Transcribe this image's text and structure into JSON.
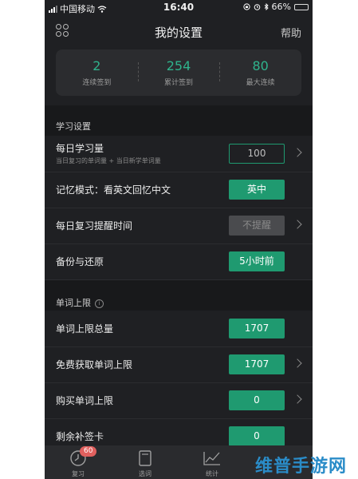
{
  "status_bar": {
    "carrier": "中国移动",
    "time": "16:40",
    "battery": "66%",
    "battery_level": 0.66
  },
  "nav": {
    "title": "我的设置",
    "help": "帮助",
    "menu_icon": "grid-dots-icon"
  },
  "stats": [
    {
      "value": "2",
      "label": "连续签到"
    },
    {
      "value": "254",
      "label": "累计签到"
    },
    {
      "value": "80",
      "label": "最大连续"
    }
  ],
  "study_section": {
    "title": "学习设置",
    "rows": [
      {
        "label": "每日学习量",
        "sub": "当日复习的单词量 + 当日新学单词量",
        "value": "100",
        "style": "outline",
        "chevron": true
      },
      {
        "label": "记忆模式：看英文回忆中文",
        "value": "英中",
        "style": "filled",
        "chevron": false
      },
      {
        "label": "每日复习提醒时间",
        "value": "不提醒",
        "style": "disabled",
        "chevron": true
      },
      {
        "label": "备份与还原",
        "value": "5小时前",
        "style": "filled",
        "chevron": false
      }
    ]
  },
  "limit_section": {
    "title": "单词上限",
    "info_icon": "info-icon",
    "rows": [
      {
        "label": "单词上限总量",
        "value": "1707",
        "style": "filled",
        "chevron": false
      },
      {
        "label": "免费获取单词上限",
        "value": "1707",
        "style": "filled",
        "chevron": true
      },
      {
        "label": "购买单词上限",
        "value": "0",
        "style": "filled",
        "chevron": true
      },
      {
        "label": "剩余补签卡",
        "value": "0",
        "style": "filled",
        "chevron": false
      }
    ]
  },
  "tabbar": {
    "tabs": [
      {
        "label": "复习",
        "icon": "clock-icon",
        "badge": "60"
      },
      {
        "label": "选词",
        "icon": "book-icon"
      },
      {
        "label": "统计",
        "icon": "chart-icon"
      },
      {
        "label": "",
        "icon": ""
      }
    ]
  },
  "watermark": "维普手游网",
  "colors": {
    "accent": "#1f9a70",
    "stat_value": "#2fb38c",
    "background": "#1f2023",
    "battery": "#f2c42a",
    "badge": "#e0605e"
  }
}
